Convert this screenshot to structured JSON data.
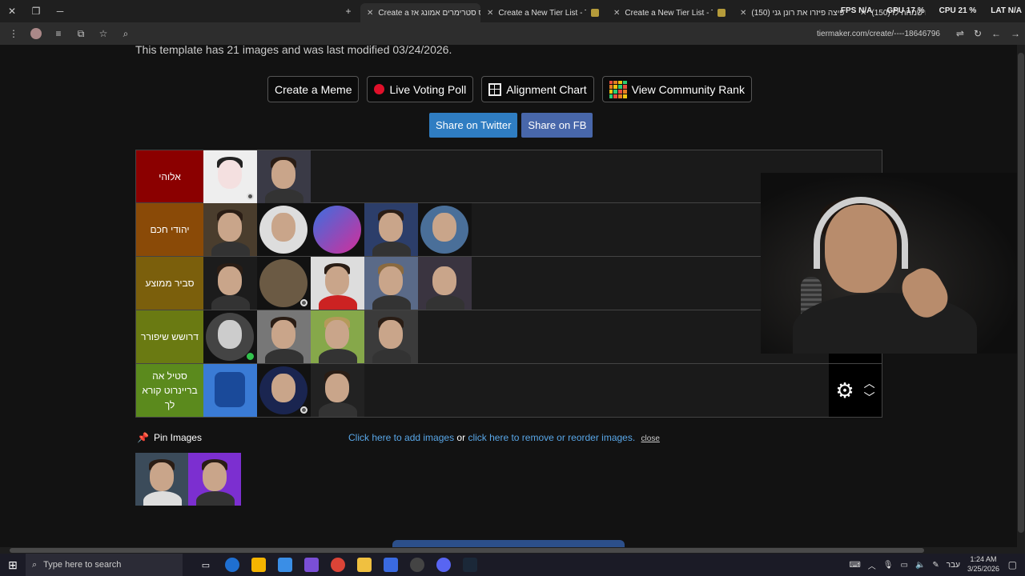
{
  "browser": {
    "tabs": [
      {
        "title": "Create a אס סטרימרים אמונג אז",
        "active": true
      },
      {
        "title": "Create a New Tier List - TierMaker",
        "active": false
      },
      {
        "title": "Create a New Tier List - TierMaker",
        "active": false
      },
      {
        "title": "(150) פיצה פיזרו את רונן גני",
        "active": false
      },
      {
        "title": "(150) השופ עם שמחה לו",
        "active": false
      }
    ],
    "overlay": {
      "fps": "FPS N/A",
      "gpu": "GPU 17 %",
      "cpu": "CPU 21 %",
      "lat": "LAT N/A"
    },
    "url": "tiermaker.com/create/----18646796"
  },
  "page": {
    "template_info": "This template has 21 images and was last modified 03/24/2026.",
    "buttons": {
      "meme": "Create a Meme",
      "poll": "Live Voting Poll",
      "alignment": "Alignment Chart",
      "rank": "View Community Rank"
    },
    "share": {
      "twitter": "Share on Twitter",
      "fb": "Share on FB"
    },
    "tiers": [
      {
        "label": "אלוהי",
        "color": "#8b0000"
      },
      {
        "label": "יהודי חכם",
        "color": "#8a4a07"
      },
      {
        "label": "סביר ממוצע",
        "color": "#7b5f0c"
      },
      {
        "label": "דרושש שיפורר",
        "color": "#6a7a12"
      },
      {
        "label": "סטיל אה בריינרוט קורא לך",
        "color": "#5b8a1d"
      }
    ],
    "pin_label": "Pin Images",
    "links": {
      "add": "Click here to add images",
      "or": "or",
      "remove": "click here to remove or reorder images.",
      "close": "close"
    }
  },
  "taskbar": {
    "search_placeholder": "Type here to search",
    "lang": "עבר",
    "time": "1:24 AM",
    "date": "3/25/2026"
  }
}
